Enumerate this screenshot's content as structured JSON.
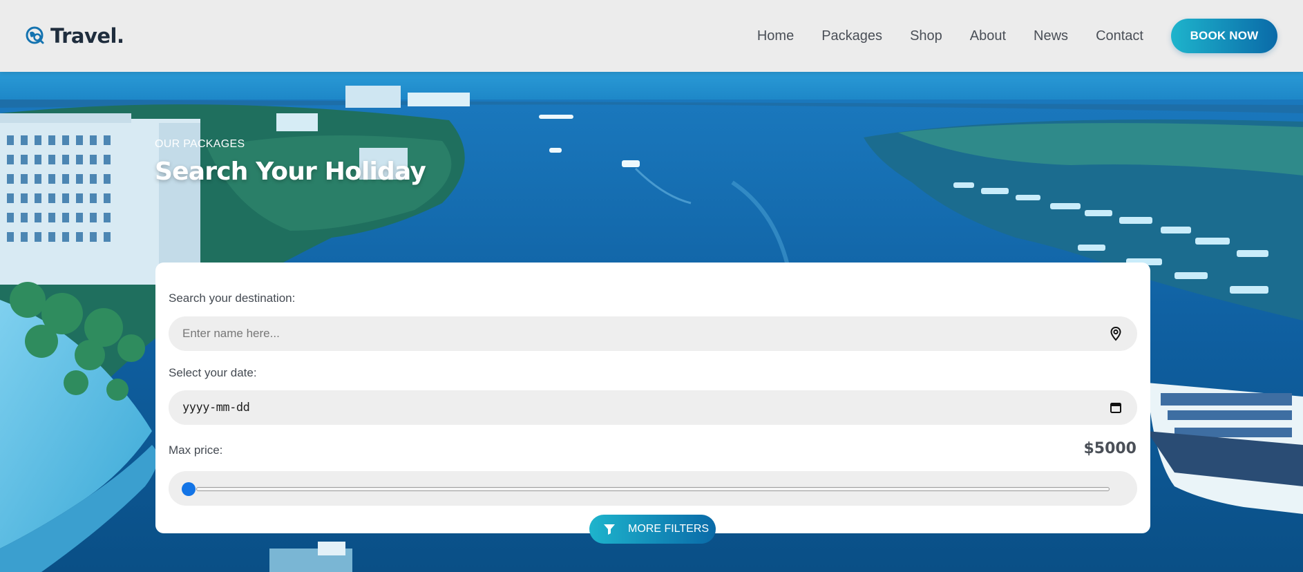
{
  "brand": {
    "name": "Travel.",
    "logo_icon": "globe-search-icon",
    "accent": "#1eb4cc",
    "accent_dark": "#0a6aa8"
  },
  "nav": {
    "items": [
      {
        "label": "Home"
      },
      {
        "label": "Packages"
      },
      {
        "label": "Shop"
      },
      {
        "label": "About"
      },
      {
        "label": "News"
      },
      {
        "label": "Contact"
      }
    ],
    "cta_label": "BOOK NOW"
  },
  "hero": {
    "eyebrow": "OUR PACKAGES",
    "title": "Search Your Holiday"
  },
  "search": {
    "destination_label": "Search your destination:",
    "destination_placeholder": "Enter name here...",
    "destination_icon": "map-pin-icon",
    "date_label": "Select your date:",
    "date_value": "yyyy-mm-dd",
    "date_icon": "calendar-icon",
    "price_label": "Max price:",
    "price_value": "$5000",
    "price_slider_fraction": 0,
    "more_filters_label": "MORE FILTERS",
    "more_filters_icon": "filter-icon"
  }
}
